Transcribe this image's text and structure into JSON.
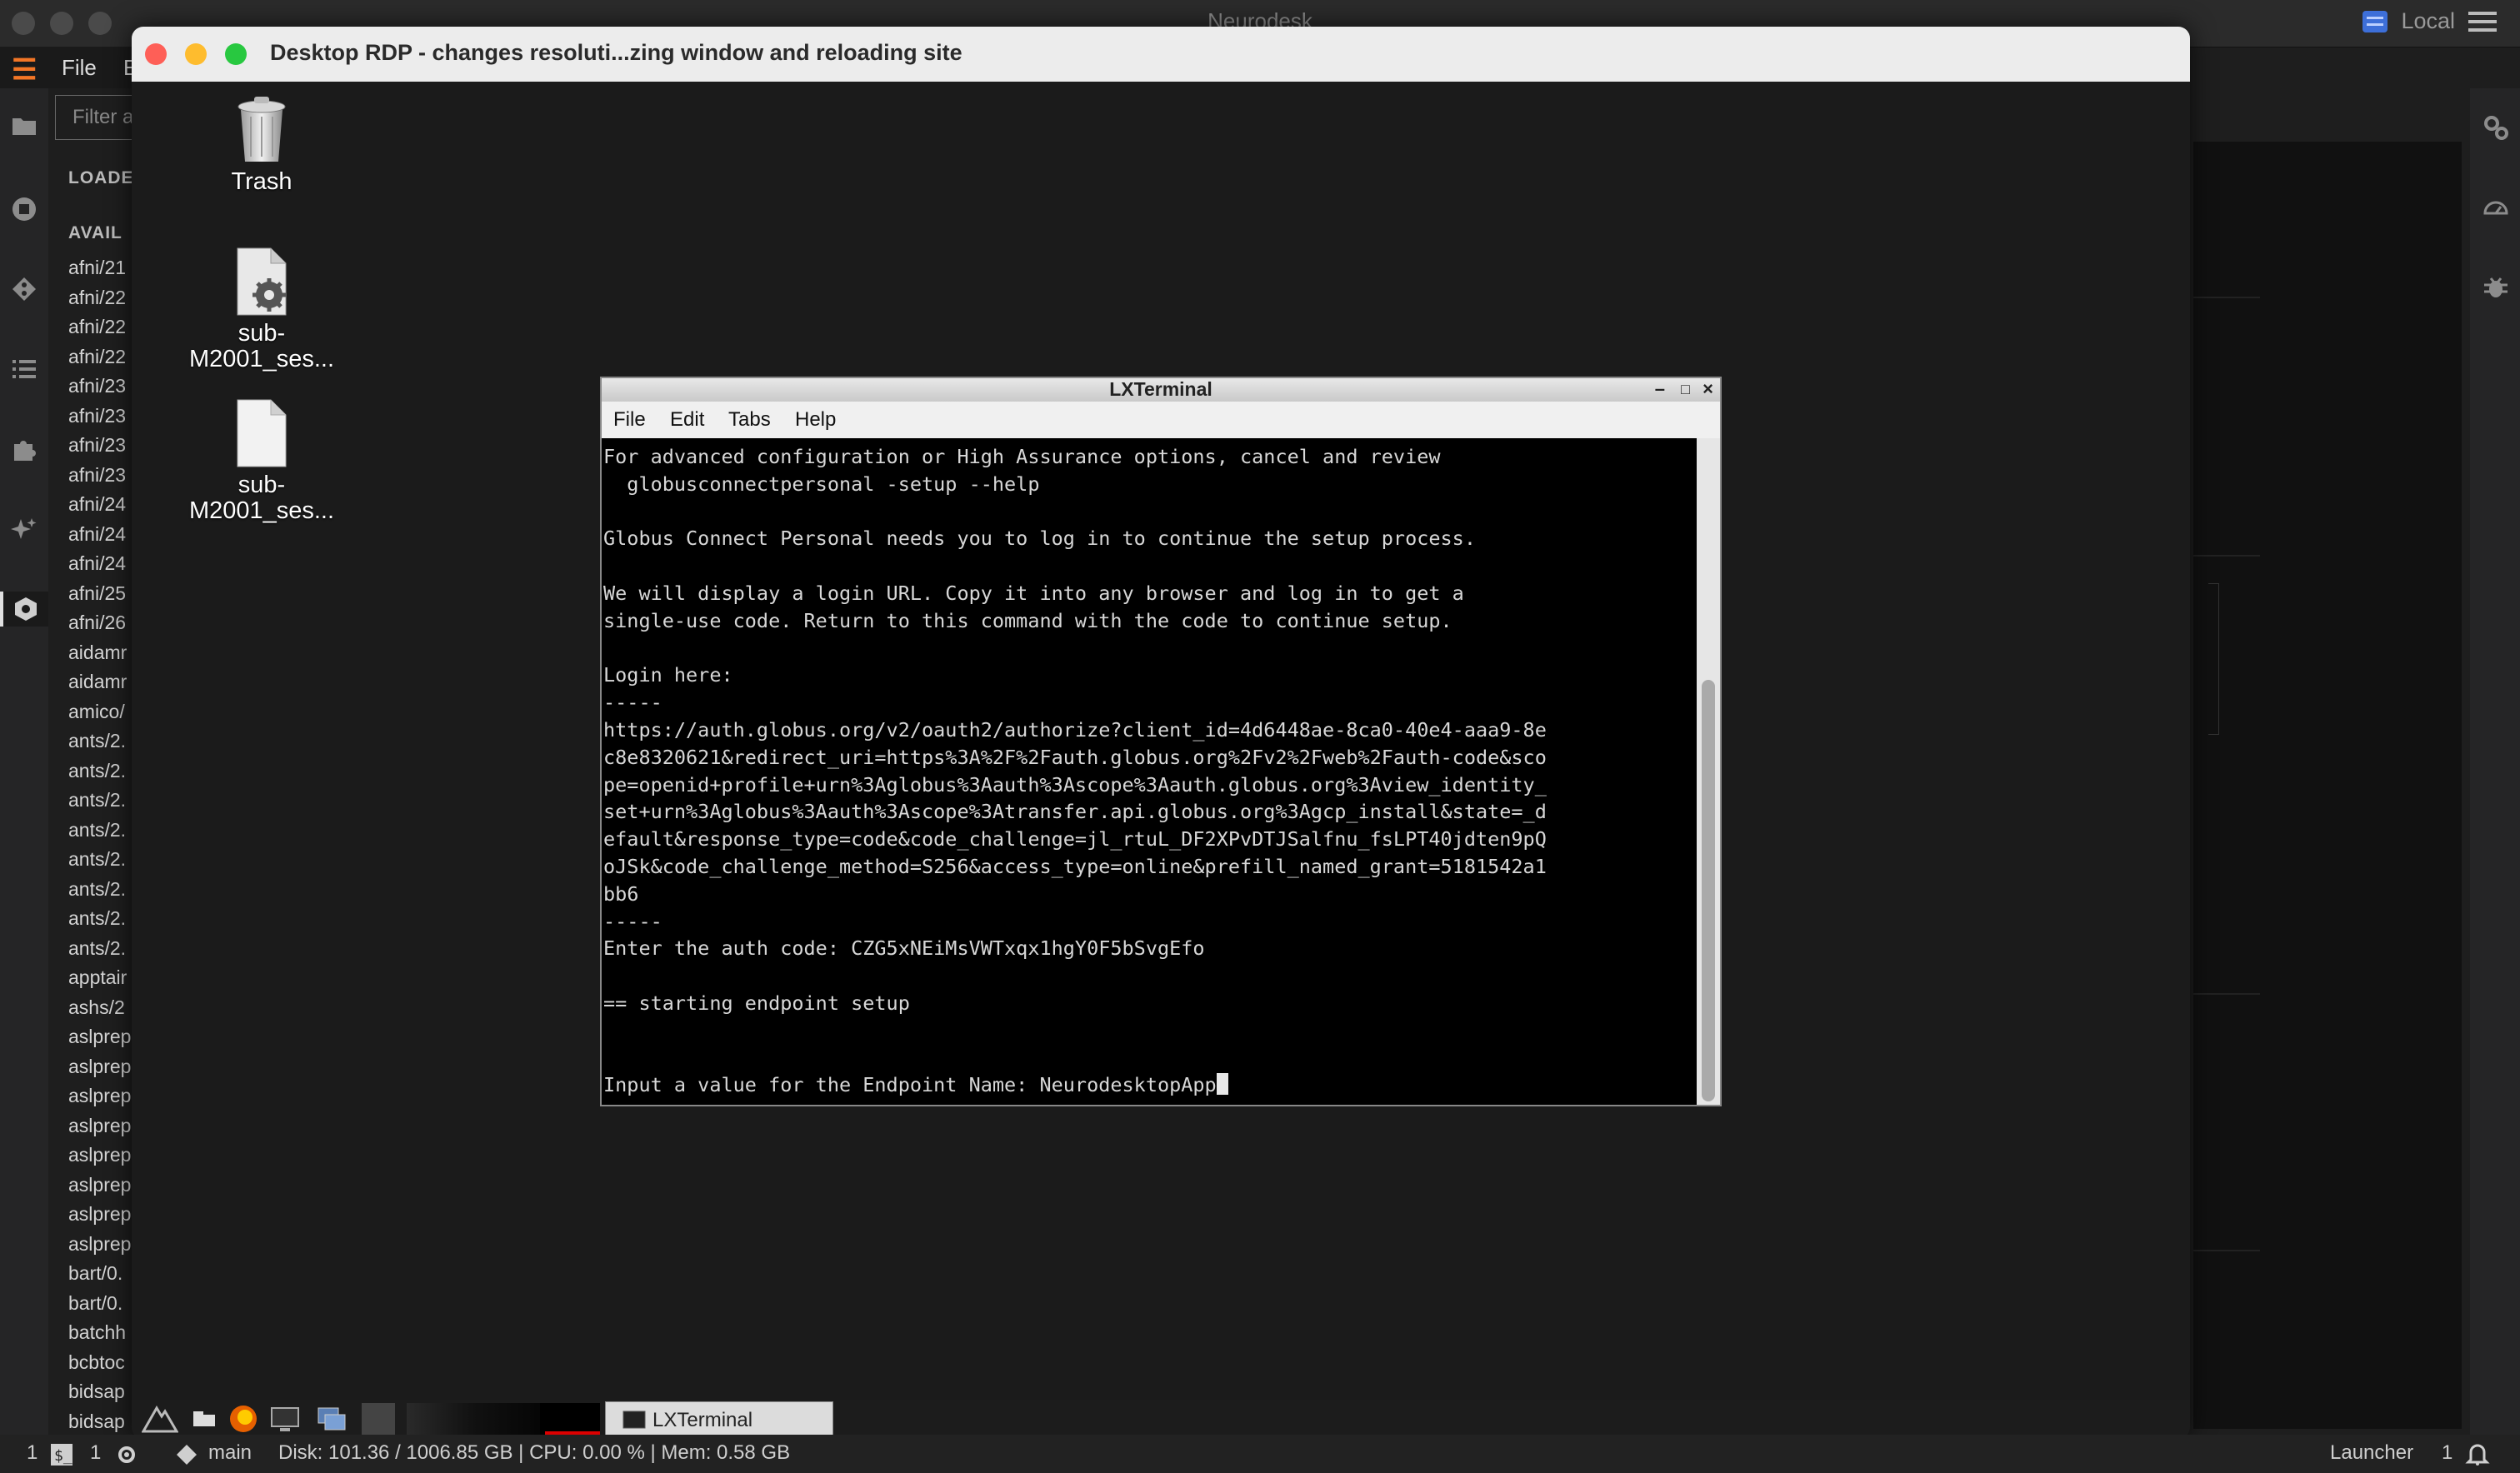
{
  "outer_app": {
    "title": "Neurodesk",
    "local_label": "Local",
    "menu_file": "File",
    "menu_partial": "E"
  },
  "module_panel": {
    "filter_placeholder": "Filter a",
    "loaded_heading": "LOADE",
    "available_heading": "AVAIL",
    "modules": [
      "afni/21",
      "afni/22",
      "afni/22",
      "afni/22",
      "afni/23",
      "afni/23",
      "afni/23",
      "afni/23",
      "afni/24",
      "afni/24",
      "afni/24",
      "afni/25",
      "afni/26",
      "aidamr",
      "aidamr",
      "amico/",
      "ants/2.",
      "ants/2.",
      "ants/2.",
      "ants/2.",
      "ants/2.",
      "ants/2.",
      "ants/2.",
      "ants/2.",
      "apptair",
      "ashs/2",
      "aslprep",
      "aslprep",
      "aslprep",
      "aslprep",
      "aslprep",
      "aslprep",
      "aslprep",
      "aslprep",
      "bart/0.",
      "bart/0.",
      "batchh",
      "bcbtoc",
      "bidsap",
      "bidsap"
    ]
  },
  "rdp_window": {
    "title": "Desktop RDP - changes resoluti...zing window and reloading site",
    "colors": {
      "close": "#fe5f57",
      "minimize": "#febc2e",
      "zoom": "#28c840"
    }
  },
  "desktop_icons": [
    {
      "icon": "trash-icon",
      "label": "Trash"
    },
    {
      "icon": "settings-file-icon",
      "label": "sub-\nM2001_ses..."
    },
    {
      "icon": "file-icon",
      "label": "sub-\nM2001_ses..."
    }
  ],
  "terminal": {
    "title": "LXTerminal",
    "menu": [
      "File",
      "Edit",
      "Tabs",
      "Help"
    ],
    "output": "For advanced configuration or High Assurance options, cancel and review\n  globusconnectpersonal -setup --help\n\nGlobus Connect Personal needs you to log in to continue the setup process.\n\nWe will display a login URL. Copy it into any browser and log in to get a\nsingle-use code. Return to this command with the code to continue setup.\n\nLogin here:\n-----\nhttps://auth.globus.org/v2/oauth2/authorize?client_id=4d6448ae-8ca0-40e4-aaa9-8e\nc8e8320621&redirect_uri=https%3A%2F%2Fauth.globus.org%2Fv2%2Fweb%2Fauth-code&sco\npe=openid+profile+urn%3Aglobus%3Aauth%3Ascope%3Aauth.globus.org%3Aview_identity_\nset+urn%3Aglobus%3Aauth%3Ascope%3Atransfer.api.globus.org%3Agcp_install&state=_d\nefault&response_type=code&code_challenge=jl_rtuL_DF2XPvDTJSalfnu_fsLPT40jdten9pQ\noJSk&code_challenge_method=S256&access_type=online&prefill_named_grant=5181542a1\nbb6\n-----\nEnter the auth code: CZG5xNEiMsVWTxqx1hgY0F5bSvgEfo\n\n== starting endpoint setup\n\n\nInput a value for the Endpoint Name: NeurodesktopApp"
  },
  "taskbar": {
    "task_label": "LXTerminal"
  },
  "statusbar": {
    "mode_count_a": "1",
    "mode_count_b": "1",
    "branch": "main",
    "resources": "Disk: 101.36 / 1006.85 GB | CPU: 0.00 % | Mem: 0.58 GB",
    "launcher": "Launcher",
    "launcher_count": "1"
  }
}
